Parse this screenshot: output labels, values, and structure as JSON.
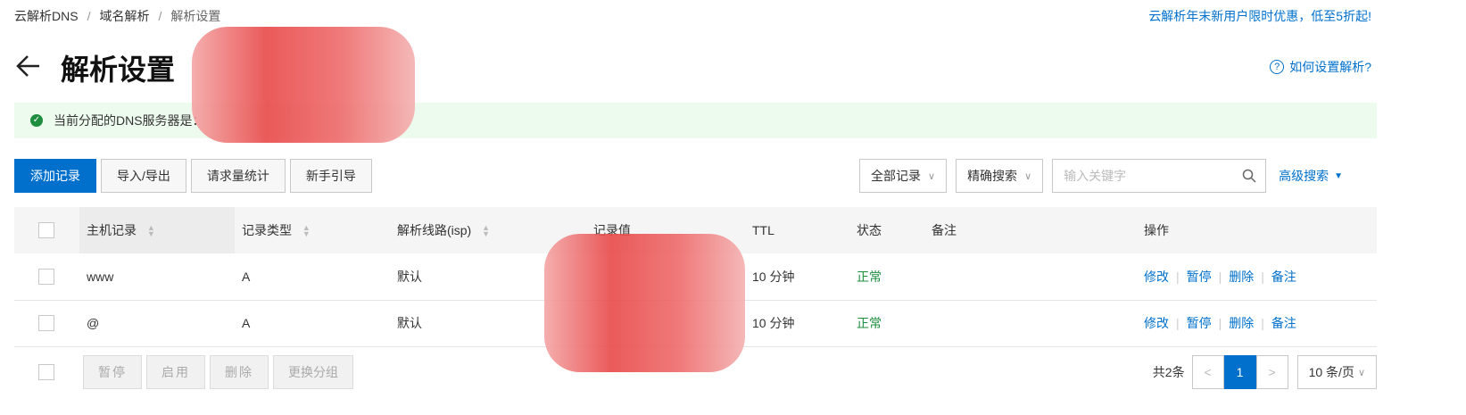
{
  "breadcrumb": {
    "root": "云解析DNS",
    "sep": "/",
    "domain": "域名解析",
    "current": "解析设置"
  },
  "promo": "云解析年末新用户限时优惠，低至5折起!",
  "page_title": "解析设置",
  "help_link": "如何设置解析?",
  "notice": {
    "text": "当前分配的DNS服务器是："
  },
  "toolbar": {
    "add": "添加记录",
    "import_export": "导入/导出",
    "stats": "请求量统计",
    "guide": "新手引导",
    "filter_select": "全部记录",
    "mode_select": "精确搜索",
    "search_placeholder": "输入关键字",
    "advanced": "高级搜索"
  },
  "table": {
    "headers": [
      "主机记录",
      "记录类型",
      "解析线路(isp)",
      "记录值",
      "TTL",
      "状态",
      "备注",
      "操作"
    ],
    "rows": [
      {
        "host": "www",
        "type": "A",
        "line": "默认",
        "value": "",
        "ttl": "10 分钟",
        "status": "正常",
        "remark": ""
      },
      {
        "host": "@",
        "type": "A",
        "line": "默认",
        "value": "",
        "ttl": "10 分钟",
        "status": "正常",
        "remark": ""
      }
    ],
    "actions": {
      "edit": "修改",
      "pause": "暂停",
      "delete": "删除",
      "remark": "备注"
    }
  },
  "bulk": {
    "pause": "暂停",
    "enable": "启用",
    "delete": "删除",
    "group": "更换分组"
  },
  "pager": {
    "total": "共2条",
    "prev": "<",
    "page": "1",
    "next": ">",
    "size": "10 条/页"
  },
  "colors": {
    "accent": "#0070cc",
    "success": "#1e8e3e",
    "notice_bg": "#edfbee"
  }
}
